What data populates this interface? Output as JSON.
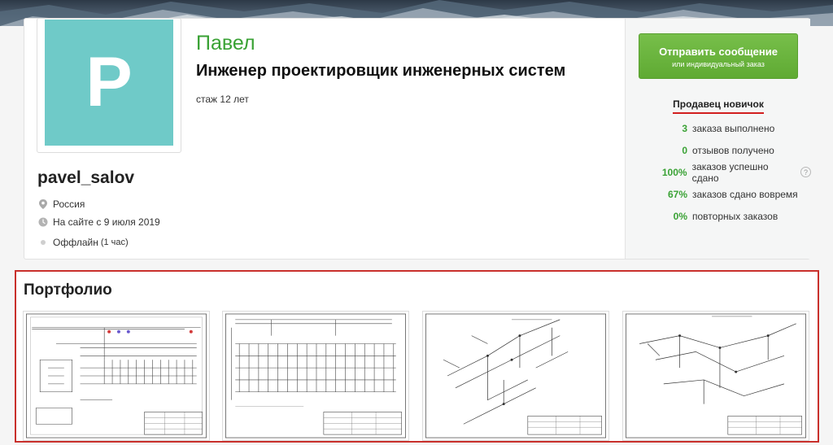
{
  "profile": {
    "avatar_letter": "P",
    "username": "pavel_salov",
    "name": "Павел",
    "title": "Инженер проектировщик инженерных систем",
    "experience": "стаж 12 лет",
    "country": "Россия",
    "since": "На сайте с 9 июля 2019",
    "status": "Оффлайн",
    "status_note": "(1 час)",
    "avatar_color": "#6fcac8"
  },
  "actions": {
    "send_label": "Отправить сообщение",
    "send_sublabel": "или индивидуальный заказ"
  },
  "seller": {
    "level": "Продавец новичок",
    "stats": [
      {
        "value": "3",
        "label": "заказа выполнено"
      },
      {
        "value": "0",
        "label": "отзывов получено"
      },
      {
        "value": "100%",
        "label": "заказов успешно сдано"
      },
      {
        "value": "67%",
        "label": "заказов сдано вовремя"
      },
      {
        "value": "0%",
        "label": "повторных заказов"
      }
    ]
  },
  "portfolio": {
    "title": "Портфолио",
    "items": [
      {
        "icon": "schematic-drawing"
      },
      {
        "icon": "schematic-drawing"
      },
      {
        "icon": "isometric-drawing"
      },
      {
        "icon": "isometric-drawing"
      }
    ]
  },
  "colors": {
    "accent_green": "#3aa235",
    "button_green": "#5faa33",
    "highlight_red": "#c9302c"
  }
}
